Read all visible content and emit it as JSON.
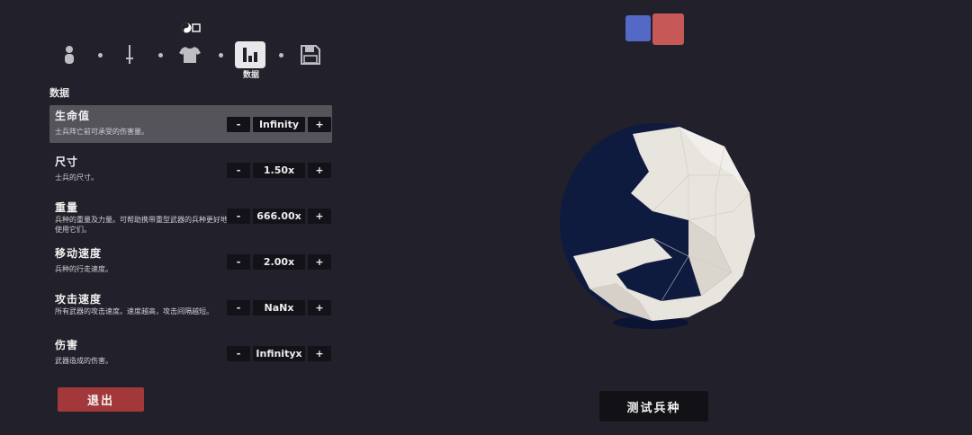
{
  "steps": {
    "items": [
      "person",
      "sword",
      "shirt",
      "stats",
      "save"
    ],
    "active_label": "数据"
  },
  "section_title": "数据",
  "stats": [
    {
      "name": "生命值",
      "desc": "士兵阵亡前可承受的伤害量。",
      "value": "Infinity",
      "minus": "-",
      "plus": "+"
    },
    {
      "name": "尺寸",
      "desc": "士兵的尺寸。",
      "value": "1.50x",
      "minus": "-",
      "plus": "+"
    },
    {
      "name": "重量",
      "desc": "兵种的重量及力量。可帮助携带重型武器的兵种更好地使用它们。",
      "value": "666.00x",
      "minus": "-",
      "plus": "+"
    },
    {
      "name": "移动速度",
      "desc": "兵种的行走速度。",
      "value": "2.00x",
      "minus": "-",
      "plus": "+"
    },
    {
      "name": "攻击速度",
      "desc": "所有武器的攻击速度。速度越高，攻击间隔越短。",
      "value": "NaNx",
      "minus": "-",
      "plus": "+"
    },
    {
      "name": "伤害",
      "desc": "武器造成的伤害。",
      "value": "Infinityx",
      "minus": "-",
      "plus": "+"
    }
  ],
  "exit_label": "退出",
  "test_label": "测试兵种",
  "team_colors": {
    "blue": "#5468c6",
    "red": "#c65858"
  }
}
